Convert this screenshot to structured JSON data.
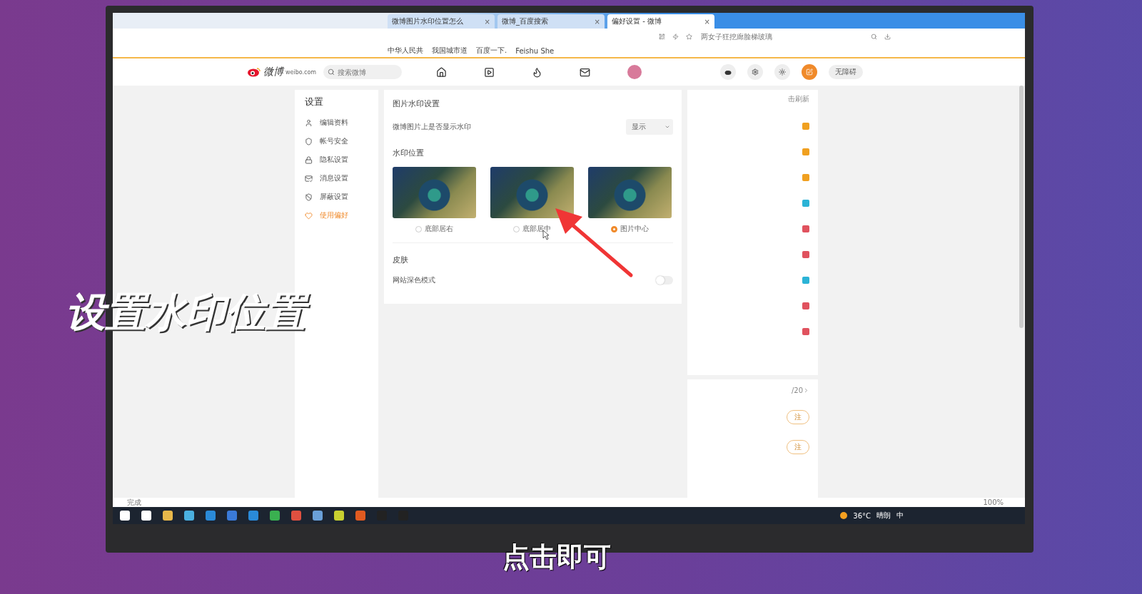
{
  "browser": {
    "tabs": [
      {
        "title": "微博图片水印位置怎么",
        "close": "×",
        "selected": false
      },
      {
        "title": "微博_百度搜索",
        "close": "×",
        "selected": false
      },
      {
        "title": "偏好设置 - 微博",
        "close": "×",
        "selected": true
      }
    ],
    "search": {
      "placeholder": "两女子狂挖廊脸梯玻璃"
    },
    "bookmarks": [
      "中华人民共",
      "我国城市道",
      "百度一下.",
      "Feishu She"
    ]
  },
  "header": {
    "logo": "微博",
    "logo_sub": "weibo.com",
    "search": {
      "placeholder": "搜索微博"
    },
    "accessibility": "无障碍"
  },
  "sidebar": {
    "title": "设置",
    "items": [
      {
        "label": "编辑资料",
        "selected": false
      },
      {
        "label": "帐号安全",
        "selected": false
      },
      {
        "label": "隐私设置",
        "selected": false
      },
      {
        "label": "消息设置",
        "selected": false
      },
      {
        "label": "屏蔽设置",
        "selected": false
      },
      {
        "label": "使用偏好",
        "selected": true
      }
    ]
  },
  "main": {
    "title": "图片水印设置",
    "show_label": "微博图片上是否显示水印",
    "show_value": "显示",
    "position_title": "水印位置",
    "positions": [
      {
        "label": "底部居右",
        "selected": false
      },
      {
        "label": "底部居中",
        "selected": false
      },
      {
        "label": "图片中心",
        "selected": true
      }
    ],
    "skin_title": "皮肤",
    "dark_label": "网站深色模式",
    "dark_on": false
  },
  "hot": {
    "refresh": "击刷新",
    "badges": [
      {
        "color": "#f0a020"
      },
      {
        "color": "#f0a020"
      },
      {
        "color": "#f0a020"
      },
      {
        "color": "#2bb3d6"
      },
      {
        "color": "#e0525e"
      },
      {
        "color": "#e0525e"
      },
      {
        "color": "#2bb3d6"
      },
      {
        "color": "#e0525e"
      },
      {
        "color": "#e0525e"
      }
    ],
    "count": "/20",
    "follows": [
      "注",
      "注"
    ]
  },
  "status": {
    "text": "完成",
    "zoom": "100%"
  },
  "taskbar": {
    "weather": "36°C",
    "condition": "晴朗",
    "ime": "中"
  },
  "caption": "设置水印位置",
  "subtitle": "点击即可"
}
